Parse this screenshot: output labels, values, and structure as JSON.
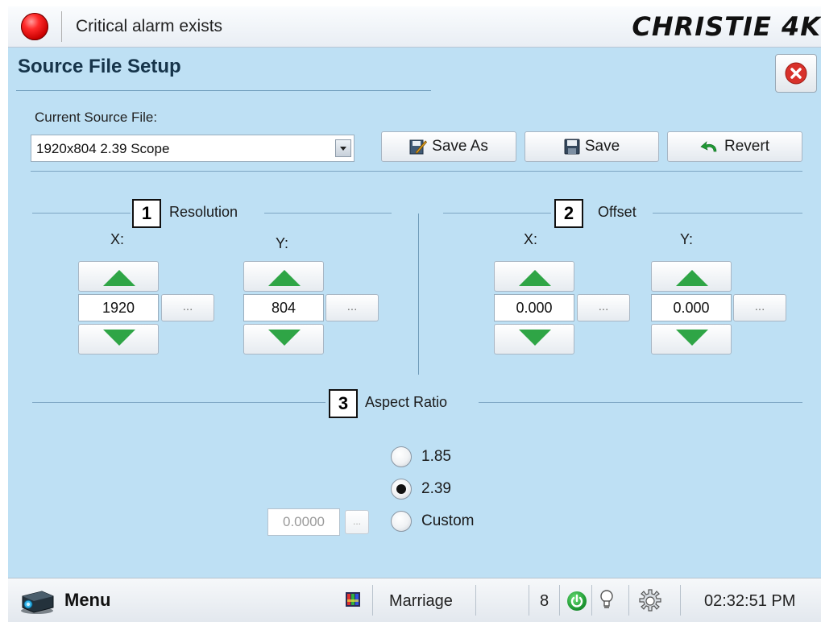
{
  "header": {
    "alarm_text": "Critical alarm exists",
    "brand": "CHRISTIE 4K",
    "alarm_color": "#e00000"
  },
  "page": {
    "title": "Source File Setup"
  },
  "source_file": {
    "label": "Current Source File:",
    "value": "1920x804 2.39 Scope"
  },
  "toolbar": {
    "save_as_label": "Save As",
    "save_label": "Save",
    "revert_label": "Revert"
  },
  "callouts": [
    "1",
    "2",
    "3"
  ],
  "resolution": {
    "title": "Resolution",
    "x_label": "X:",
    "y_label": "Y:",
    "x_value": "1920",
    "y_value": "804",
    "ellipsis": "..."
  },
  "offset": {
    "title": "Offset",
    "x_label": "X:",
    "y_label": "Y:",
    "x_value": "0.000",
    "y_value": "0.000",
    "ellipsis": "..."
  },
  "aspect_ratio": {
    "title": "Aspect Ratio",
    "options": [
      {
        "label": "1.85",
        "selected": false
      },
      {
        "label": "2.39",
        "selected": true
      },
      {
        "label": "Custom",
        "selected": false
      }
    ],
    "custom_value": "0.0000",
    "ellipsis": "..."
  },
  "statusbar": {
    "menu_label": "Menu",
    "marriage_label": "Marriage",
    "count": "8",
    "time": "02:32:51 PM"
  },
  "colors": {
    "panel_bg": "#bee0f4",
    "arrow_green": "#2fa546",
    "close_red": "#d8312b"
  }
}
